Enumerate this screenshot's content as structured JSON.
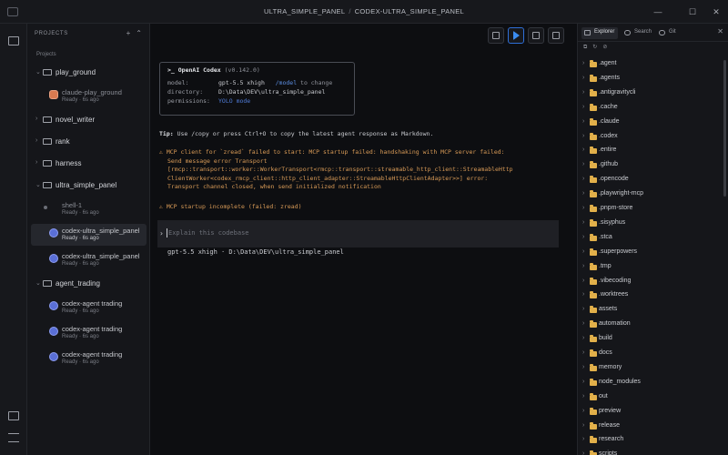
{
  "window": {
    "app_name": "ULTRA_SIMPLE_PANEL",
    "separator": "/",
    "document_name": "CODEX-ULTRA_SIMPLE_PANEL",
    "controls": {
      "minimize": "—",
      "maximize": "☐",
      "close": "✕"
    }
  },
  "activity_bar": {
    "icons": [
      "terminal-icon",
      "notes-icon",
      "settings-sliders-icon"
    ]
  },
  "sidebar": {
    "header": "PROJECTS",
    "actions": {
      "add": "+",
      "collapse": "⌃"
    },
    "root_label": "Projects",
    "items": [
      {
        "type": "folder",
        "label": "play_ground",
        "chevron": "⌄"
      },
      {
        "type": "session",
        "label": "claude-play_ground",
        "status": "Ready · 6s ago",
        "icon": "claude",
        "dim": true
      },
      {
        "type": "folder",
        "label": "novel_writer",
        "chevron": "›"
      },
      {
        "type": "folder",
        "label": "rank",
        "chevron": "›"
      },
      {
        "type": "folder",
        "label": "harness",
        "chevron": "›"
      },
      {
        "type": "folder",
        "label": "ultra_simple_panel",
        "chevron": "⌄"
      },
      {
        "type": "session",
        "label": "shell-1",
        "status": "Ready · 6s ago",
        "icon": "shell",
        "dim": true
      },
      {
        "type": "session",
        "label": "codex-ultra_simple_panel",
        "status": "Ready · 6s ago",
        "icon": "codex",
        "active": true
      },
      {
        "type": "session",
        "label": "codex-ultra_simple_panel",
        "status": "Ready · 6s ago",
        "icon": "codex"
      },
      {
        "type": "folder",
        "label": "agent_trading",
        "chevron": "⌄"
      },
      {
        "type": "session",
        "label": "codex-agent trading",
        "status": "Ready · 6s ago",
        "icon": "codex"
      },
      {
        "type": "session",
        "label": "codex-agent trading",
        "status": "Ready · 6s ago",
        "icon": "codex"
      },
      {
        "type": "session",
        "label": "codex-agent trading",
        "status": "Ready · 6s ago",
        "icon": "codex"
      }
    ]
  },
  "terminal": {
    "codex_box": {
      "prompt": ">_",
      "title": "OpenAI Codex",
      "version": "(v0.142.0)",
      "model_key": "model:",
      "model_value": "gpt-5.5 xhigh",
      "model_hint": "/model",
      "model_hint_rest": "to change",
      "directory_key": "directory:",
      "directory_value": "D:\\Data\\DEV\\ultra_simple_panel",
      "permissions_key": "permissions:",
      "permissions_value": "YOLO mode"
    },
    "tip_label": "Tip:",
    "tip_text": "Use /copy or press Ctrl+O to copy the latest agent response as Markdown.",
    "warning1_lines": [
      "⚠ MCP client for `zread` failed to start: MCP startup failed: handshaking with MCP server failed:",
      "Send message error Transport",
      "[rmcp::transport::worker::WorkerTransport<rmcp::transport::streamable_http_client::StreamableHttp",
      "ClientWorker<codex_rmcp_client::http_client_adapter::StreamableHttpClientAdapter>>] error:",
      "Transport channel closed, when send initialized notification"
    ],
    "warning2": "⚠ MCP startup incomplete (failed: zread)",
    "input_chevron": "›",
    "input_placeholder": "Explain this codebase",
    "status_line": "gpt-5.5 xhigh · D:\\Data\\DEV\\ultra_simple_panel"
  },
  "explorer": {
    "tabs": [
      "Explorer",
      "Search",
      "Git"
    ],
    "active_tab": "Explorer",
    "close": "✕",
    "actions": [
      "⧉",
      "↻",
      "⊘"
    ],
    "entries": [
      ".agent",
      ".agents",
      ".antigravitycli",
      ".cache",
      ".claude",
      ".codex",
      ".entire",
      ".github",
      ".opencode",
      ".playwright-mcp",
      ".pnpm-store",
      ".sisyphus",
      ".stca",
      ".superpowers",
      ".tmp",
      ".vibecoding",
      ".worktrees",
      "assets",
      "automation",
      "build",
      "docs",
      "memory",
      "node_modules",
      "out",
      "preview",
      "release",
      "research",
      "scripts"
    ]
  }
}
